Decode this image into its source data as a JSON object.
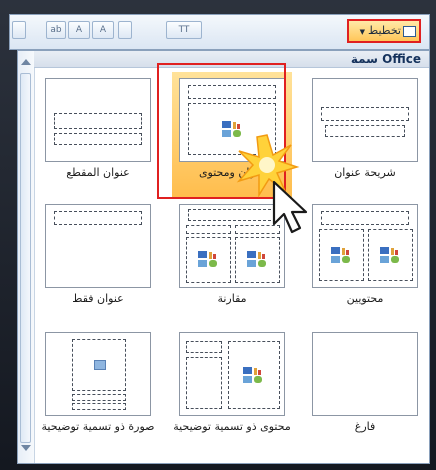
{
  "ribbon": {
    "layout_button_label": "تخطيط",
    "small_buttons": [
      "A",
      "A",
      "ab",
      "TT"
    ]
  },
  "gallery": {
    "section_title": "سمة Office",
    "items": [
      {
        "label": "شريحة عنوان"
      },
      {
        "label": "عنوان ومحتوى"
      },
      {
        "label": "عنوان المقطع"
      },
      {
        "label": "محتويين"
      },
      {
        "label": "مقارنة"
      },
      {
        "label": "عنوان فقط"
      },
      {
        "label": "فارغ"
      },
      {
        "label": "محتوى ذو تسمية توضيحية"
      },
      {
        "label": "صورة ذو تسمية توضيحية"
      }
    ],
    "selected_index": 1
  },
  "colors": {
    "highlight": "#ffc659",
    "callout_red": "#e02020"
  },
  "icons": [
    "layout-icon",
    "dropdown-arrow-icon",
    "content-placeholder-icon",
    "mouse-pointer-icon",
    "click-burst-icon"
  ]
}
